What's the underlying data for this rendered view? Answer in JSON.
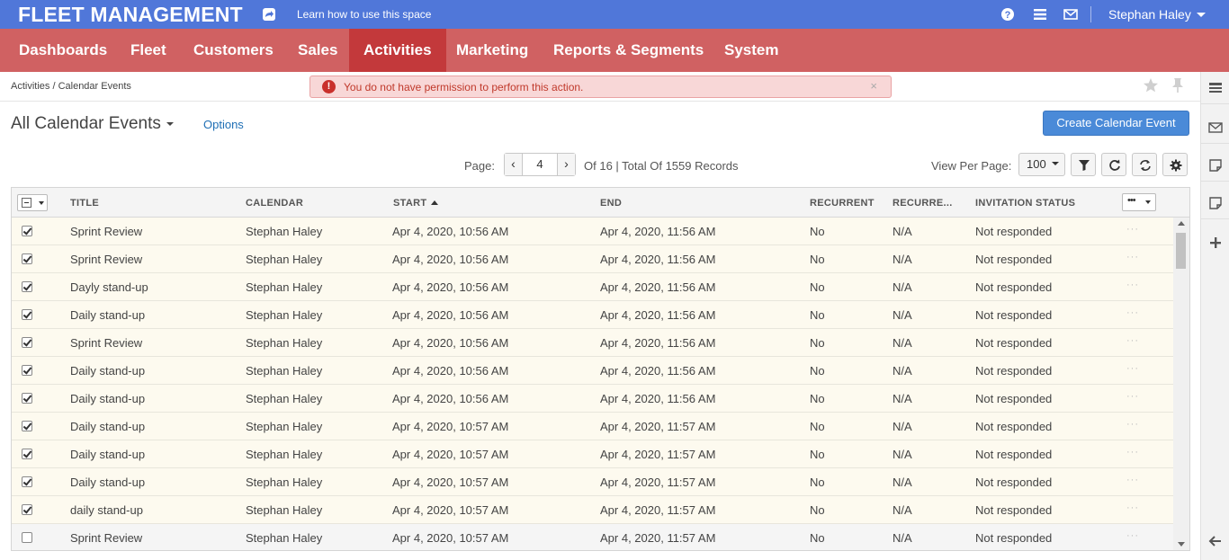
{
  "topbar": {
    "brand": "FLEET MANAGEMENT",
    "learn_link": "Learn how to use this space",
    "user_name": "Stephan Haley",
    "icons": [
      "share-icon",
      "help-icon",
      "menu-icon",
      "mail-icon"
    ]
  },
  "nav": {
    "items": [
      {
        "label": "Dashboards",
        "active": false
      },
      {
        "label": "Fleet",
        "active": false
      },
      {
        "label": "Customers",
        "active": false
      },
      {
        "label": "Sales",
        "active": false
      },
      {
        "label": "Activities",
        "active": true
      },
      {
        "label": "Marketing",
        "active": false
      },
      {
        "label": "Reports & Segments",
        "active": false
      },
      {
        "label": "System",
        "active": false
      }
    ]
  },
  "breadcrumb": "Activities / Calendar Events",
  "alert": {
    "message": "You do not have permission to perform this action.",
    "close": "×"
  },
  "header": {
    "title": "All Calendar Events",
    "options_label": "Options",
    "create_button": "Create Calendar Event"
  },
  "pagination": {
    "page_label": "Page:",
    "current_page": "4",
    "prev": "‹",
    "next": "›",
    "total_text": "Of 16 | Total Of 1559 Records",
    "view_per_page_label": "View Per Page:",
    "view_per_page_value": "100"
  },
  "grid": {
    "columns": [
      "TITLE",
      "CALENDAR",
      "START",
      "END",
      "RECURRENT",
      "RECURRE...",
      "INVITATION STATUS"
    ],
    "column_menu": "•••",
    "rows": [
      {
        "checked": true,
        "title": "Sprint Review",
        "calendar": "Stephan Haley",
        "start": "Apr 4, 2020, 10:56 AM",
        "end": "Apr 4, 2020, 11:56 AM",
        "recurrent": "No",
        "recurrence": "N/A",
        "status": "Not responded",
        "actions": "···"
      },
      {
        "checked": true,
        "title": "Sprint Review",
        "calendar": "Stephan Haley",
        "start": "Apr 4, 2020, 10:56 AM",
        "end": "Apr 4, 2020, 11:56 AM",
        "recurrent": "No",
        "recurrence": "N/A",
        "status": "Not responded",
        "actions": "···"
      },
      {
        "checked": true,
        "title": "Dayly stand-up",
        "calendar": "Stephan Haley",
        "start": "Apr 4, 2020, 10:56 AM",
        "end": "Apr 4, 2020, 11:56 AM",
        "recurrent": "No",
        "recurrence": "N/A",
        "status": "Not responded",
        "actions": "···"
      },
      {
        "checked": true,
        "title": "Daily stand-up",
        "calendar": "Stephan Haley",
        "start": "Apr 4, 2020, 10:56 AM",
        "end": "Apr 4, 2020, 11:56 AM",
        "recurrent": "No",
        "recurrence": "N/A",
        "status": "Not responded",
        "actions": "···"
      },
      {
        "checked": true,
        "title": "Sprint Review",
        "calendar": "Stephan Haley",
        "start": "Apr 4, 2020, 10:56 AM",
        "end": "Apr 4, 2020, 11:56 AM",
        "recurrent": "No",
        "recurrence": "N/A",
        "status": "Not responded",
        "actions": "···"
      },
      {
        "checked": true,
        "title": "Daily stand-up",
        "calendar": "Stephan Haley",
        "start": "Apr 4, 2020, 10:56 AM",
        "end": "Apr 4, 2020, 11:56 AM",
        "recurrent": "No",
        "recurrence": "N/A",
        "status": "Not responded",
        "actions": "···"
      },
      {
        "checked": true,
        "title": "Daily stand-up",
        "calendar": "Stephan Haley",
        "start": "Apr 4, 2020, 10:56 AM",
        "end": "Apr 4, 2020, 11:56 AM",
        "recurrent": "No",
        "recurrence": "N/A",
        "status": "Not responded",
        "actions": "···"
      },
      {
        "checked": true,
        "title": "Daily stand-up",
        "calendar": "Stephan Haley",
        "start": "Apr 4, 2020, 10:57 AM",
        "end": "Apr 4, 2020, 11:57 AM",
        "recurrent": "No",
        "recurrence": "N/A",
        "status": "Not responded",
        "actions": "···"
      },
      {
        "checked": true,
        "title": "Daily stand-up",
        "calendar": "Stephan Haley",
        "start": "Apr 4, 2020, 10:57 AM",
        "end": "Apr 4, 2020, 11:57 AM",
        "recurrent": "No",
        "recurrence": "N/A",
        "status": "Not responded",
        "actions": "···"
      },
      {
        "checked": true,
        "title": "Daily stand-up",
        "calendar": "Stephan Haley",
        "start": "Apr 4, 2020, 10:57 AM",
        "end": "Apr 4, 2020, 11:57 AM",
        "recurrent": "No",
        "recurrence": "N/A",
        "status": "Not responded",
        "actions": "···"
      },
      {
        "checked": true,
        "title": "daily stand-up",
        "calendar": "Stephan Haley",
        "start": "Apr 4, 2020, 10:57 AM",
        "end": "Apr 4, 2020, 11:57 AM",
        "recurrent": "No",
        "recurrence": "N/A",
        "status": "Not responded",
        "actions": "···"
      },
      {
        "checked": false,
        "title": "Sprint Review",
        "calendar": "Stephan Haley",
        "start": "Apr 4, 2020, 10:57 AM",
        "end": "Apr 4, 2020, 11:57 AM",
        "recurrent": "No",
        "recurrence": "N/A",
        "status": "Not responded",
        "actions": "···"
      }
    ]
  },
  "colors": {
    "topbar": "#5077d9",
    "nav": "#d06162",
    "nav_active": "#c3393b",
    "primary_button": "#4a8ad8",
    "alert_bg": "#f8d7d7",
    "selected_row": "#fdfaef"
  }
}
